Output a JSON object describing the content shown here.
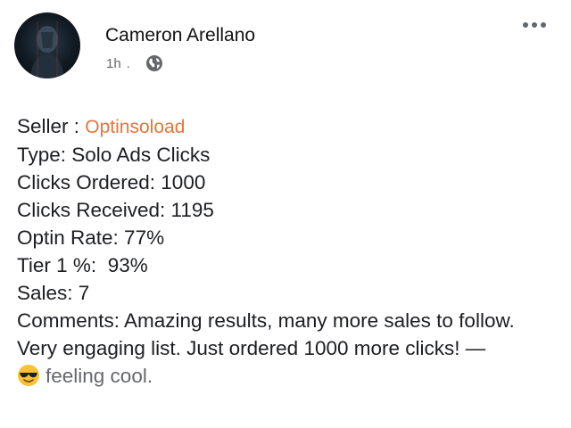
{
  "post": {
    "author": "Cameron Arellano",
    "time": "1h",
    "separator": ".",
    "audience_icon": "globe-icon",
    "more_icon": "more-options-icon"
  },
  "content": {
    "seller_label": "Seller :",
    "seller_name": "Optinsoload",
    "type": "Type: Solo Ads Clicks",
    "clicks_ordered": "Clicks Ordered: 1000",
    "clicks_received": "Clicks Received: 1195",
    "optin_rate": "Optin Rate: 77%",
    "tier1": "Tier 1 %:  93%",
    "sales": "Sales: 7",
    "comments": "Comments: Amazing results, many more sales to follow.",
    "engaging": "Very engaging list. Just ordered 1000 more clicks! —",
    "feeling_icon": "sunglasses-emoji-icon",
    "feeling": "feeling cool."
  },
  "colors": {
    "seller_accent": "#e8743b",
    "meta_text": "#65676b"
  }
}
